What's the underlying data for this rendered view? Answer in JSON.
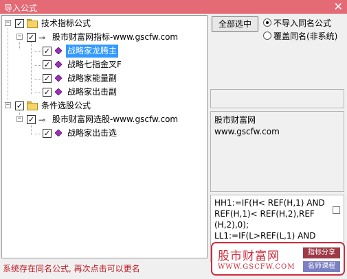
{
  "window": {
    "title": "导入公式",
    "close_glyph": "✕"
  },
  "tree": {
    "nodes": [
      {
        "label": "技术指标公式",
        "checked": true
      },
      {
        "label": "股市财富网指标-www.gscfw.com",
        "checked": true
      },
      {
        "label": "战略家龙腾主",
        "checked": true,
        "selected": true
      },
      {
        "label": "战略七指金叉F",
        "checked": true
      },
      {
        "label": "战略家能量副",
        "checked": true
      },
      {
        "label": "战略家出击副",
        "checked": true
      },
      {
        "label": "条件选股公式",
        "checked": true
      },
      {
        "label": "股市财富网选股-www.gscfw.com",
        "checked": true
      },
      {
        "label": "战略家出击选",
        "checked": true
      }
    ],
    "checkmark": "✓",
    "expander_glyph": "−",
    "key_glyph": "⊸"
  },
  "actions": {
    "select_all_label": "全部选中"
  },
  "options": {
    "no_import_same_name": "不导入同名公式",
    "overwrite_same_name": "覆盖同名(非系统)",
    "selected": "no_import_same_name"
  },
  "description": {
    "line1": "股市财富网",
    "line2": "www.gscfw.com"
  },
  "code": {
    "text": "HH1:=IF(H< REF(H,1) AND REF(H,1)< REF(H,2),REF (H,2),0);\nLL1:=IF(L>REF(L,1) AND REF"
  },
  "watermark": {
    "brand": "股市财富网",
    "url": "WWW.GSCFW.COM",
    "badge1": "指标分享",
    "badge2": "名师课程"
  },
  "status": {
    "message": "系统存在同名公式, 再次点击可以更名"
  },
  "colors": {
    "titlebar": "#e46a76",
    "selection": "#3399ff",
    "status_text": "#c0151f",
    "watermark": "#d02b3b"
  }
}
